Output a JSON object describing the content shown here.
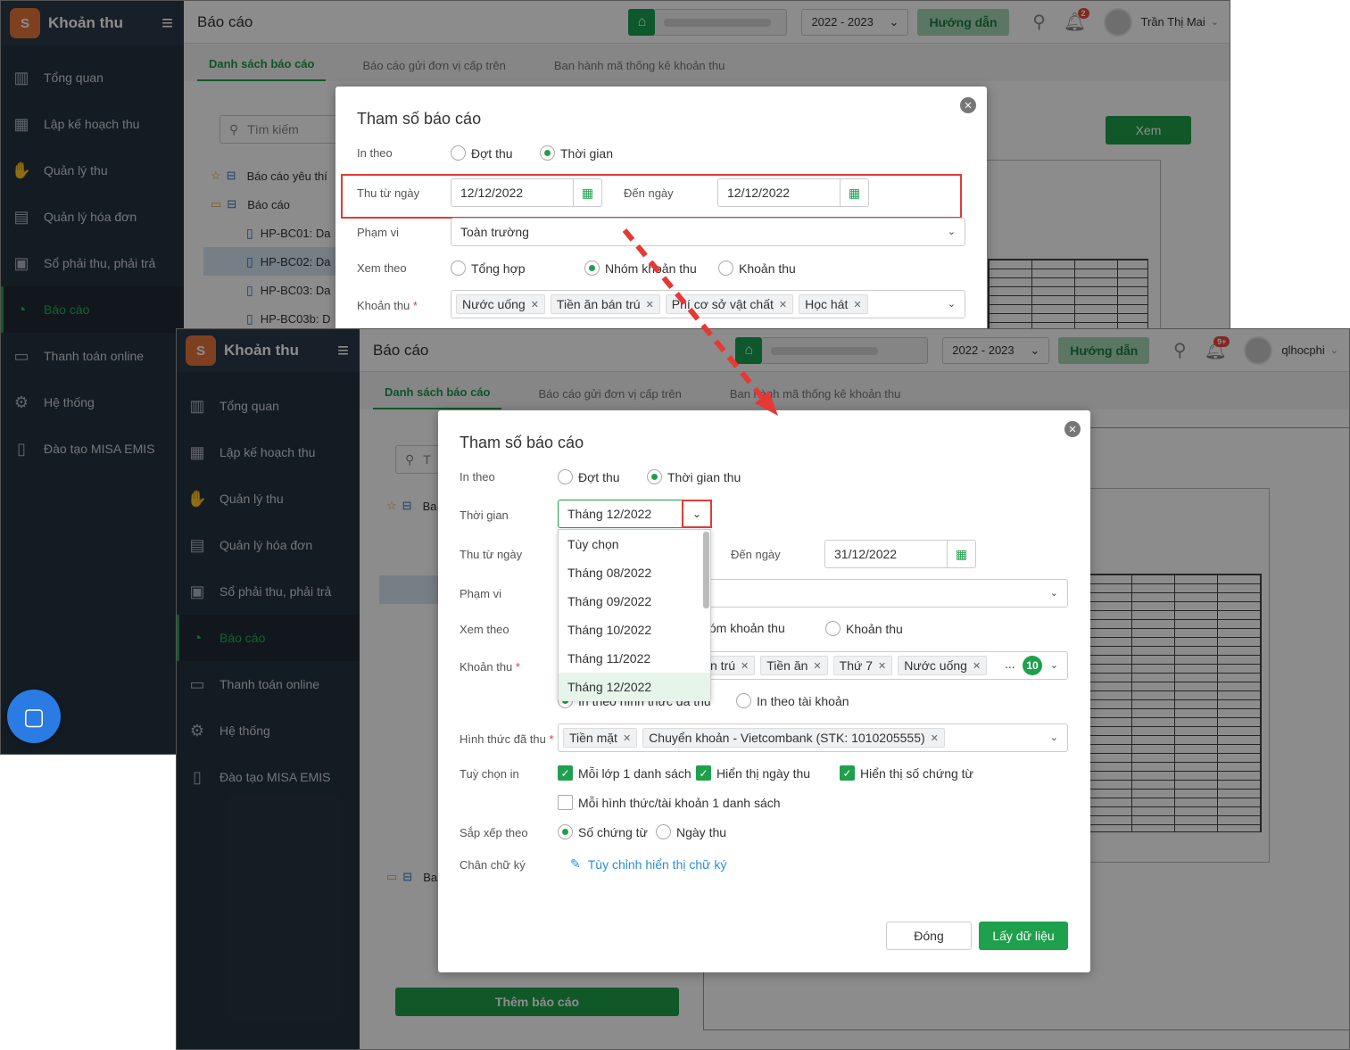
{
  "sidebar": {
    "app_name": "Khoản thu",
    "logo_text": "S",
    "items": [
      {
        "label": "Tổng quan",
        "icon": "bar-chart-icon"
      },
      {
        "label": "Lập kế hoạch thu",
        "icon": "calendar-money-icon"
      },
      {
        "label": "Quản lý thu",
        "icon": "hand-money-icon"
      },
      {
        "label": "Quản lý hóa đơn",
        "icon": "invoice-icon"
      },
      {
        "label": "Sổ phải thu, phải trả",
        "icon": "ledger-icon"
      },
      {
        "label": "Báo cáo",
        "icon": "pie-chart-icon"
      },
      {
        "label": "Thanh toán online",
        "icon": "card-icon"
      },
      {
        "label": "Hệ thống",
        "icon": "gear-icon"
      },
      {
        "label": "Đào tạo MISA EMIS",
        "icon": "book-icon"
      }
    ]
  },
  "header": {
    "title": "Báo cáo",
    "year": "2022 - 2023",
    "guide_label": "Hướng dẫn",
    "user_a": "Trần Thị Mai",
    "user_b": "qlhocphi",
    "badge_a": "2",
    "badge_b": "9+"
  },
  "tabs": [
    "Danh sách báo cáo",
    "Báo cáo gửi đơn vị cấp trên",
    "Ban hành mã thống kê khoản thu"
  ],
  "list": {
    "search_placeholder": "Tìm kiếm",
    "group_fav": "Báo cáo yêu thí",
    "group_reports": "Báo cáo",
    "items": [
      "HP-BC01: Da",
      "HP-BC02: Da",
      "HP-BC03: Da",
      "HP-BC03b: D"
    ],
    "group_b1": "Ba",
    "group_b2": "Ba",
    "add_report": "Thêm báo cáo",
    "search_b": "T"
  },
  "view_button": "Xem",
  "modal_a": {
    "title": "Tham số báo cáo",
    "in_theo_label": "In theo",
    "opt_dot_thu": "Đợt thu",
    "opt_thoi_gian": "Thời gian",
    "from_label": "Thu từ ngày",
    "from_value": "12/12/2022",
    "to_label": "Đến ngày",
    "to_value": "12/12/2022",
    "scope_label": "Phạm vi",
    "scope_value": "Toàn trường",
    "view_label": "Xem theo",
    "view_opts": [
      "Tổng hợp",
      "Nhóm khoản thu",
      "Khoản thu"
    ],
    "khoan_thu_label": "Khoản thu",
    "khoan_thu_tags": [
      "Nước uống",
      "Tiền ăn bán trú",
      "Phí cơ sở vật chất",
      "Học hát"
    ]
  },
  "modal_b": {
    "title": "Tham số báo cáo",
    "in_theo_label": "In theo",
    "opt_dot_thu": "Đợt thu",
    "opt_thoi_gian_thu": "Thời gian thu",
    "time_label": "Thời gian",
    "time_value": "Tháng 12/2022",
    "time_options": [
      "Tùy chọn",
      "Tháng 08/2022",
      "Tháng 09/2022",
      "Tháng 10/2022",
      "Tháng 11/2022",
      "Tháng 12/2022"
    ],
    "from_label": "Thu từ ngày",
    "to_label": "Đến ngày",
    "to_value": "31/12/2022",
    "scope_label": "Phạm vi",
    "view_label": "Xem theo",
    "view_opts": [
      "Nhóm khoản thu",
      "Khoản thu"
    ],
    "khoan_thu_label": "Khoản thu",
    "khoan_thu_tags": [
      "n trú",
      "Tiền ăn",
      "Thứ 7",
      "Nước uống"
    ],
    "khoan_thu_more": "...",
    "khoan_thu_count": "10",
    "print_opt1": "In theo hình thức đã thu",
    "print_opt2": "In theo tài khoản",
    "payment_label": "Hình thức đã thu",
    "payment_tags": [
      "Tiền mặt",
      "Chuyển khoản - Vietcombank (STK: 1010205555)"
    ],
    "print_options_label": "Tuỳ chọn in",
    "chk1": "Mỗi lớp 1 danh sách",
    "chk2": "Hiển thị ngày thu",
    "chk3": "Hiển thị số chứng từ",
    "chk4": "Mỗi hình thức/tài khoản 1 danh sách",
    "sort_label": "Sắp xếp theo",
    "sort1": "Số chứng từ",
    "sort2": "Ngày thu",
    "sign_label": "Chân chữ ký",
    "sign_link": "Tùy chỉnh hiển thị chữ ký",
    "close_btn": "Đóng",
    "fetch_btn": "Lấy dữ liệu"
  },
  "colors": {
    "green": "#1fa04c",
    "sidebar": "#263340",
    "highlight": "#e53935"
  }
}
